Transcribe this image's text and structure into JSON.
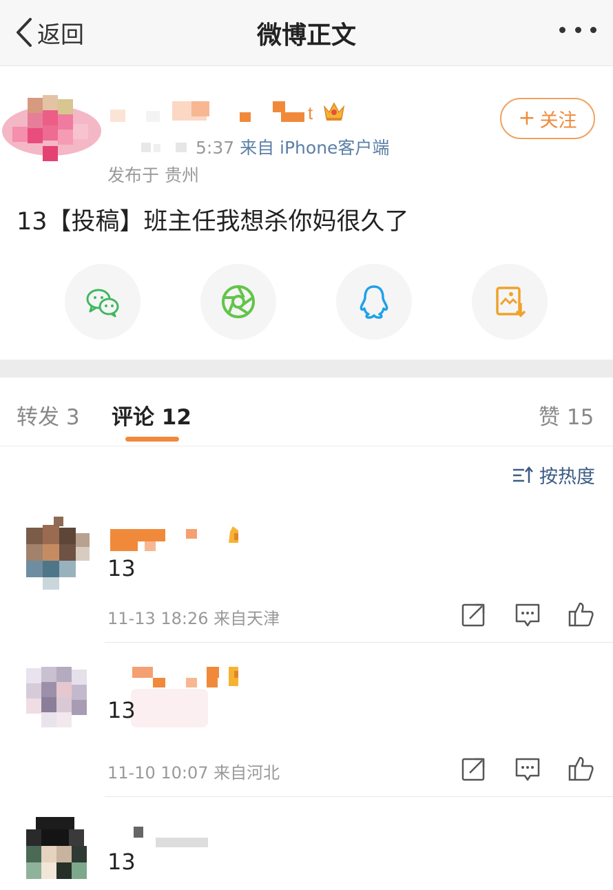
{
  "navbar": {
    "back_label": "返回",
    "title": "微博正文"
  },
  "post": {
    "time_fragment": "5:37",
    "source": "来自 iPhone客户端",
    "location": "发布于 贵州",
    "follow_label": "关注",
    "text": "13【投稿】班主任我想杀你妈很久了"
  },
  "share_icons": [
    "wechat-icon",
    "moments-icon",
    "qq-icon",
    "save-image-icon"
  ],
  "tabs": {
    "repost": "转发 3",
    "comments": "评论 12",
    "likes": "赞 15"
  },
  "sort_label": "按热度",
  "comments": [
    {
      "text": "13",
      "meta": "11-13 18:26 来自天津"
    },
    {
      "text": "13",
      "meta": "11-10 10:07 来自河北"
    },
    {
      "text": "13",
      "meta": ""
    }
  ],
  "colors": {
    "accent": "#f08a3a",
    "link": "#5b7fa6",
    "muted": "#999999"
  }
}
